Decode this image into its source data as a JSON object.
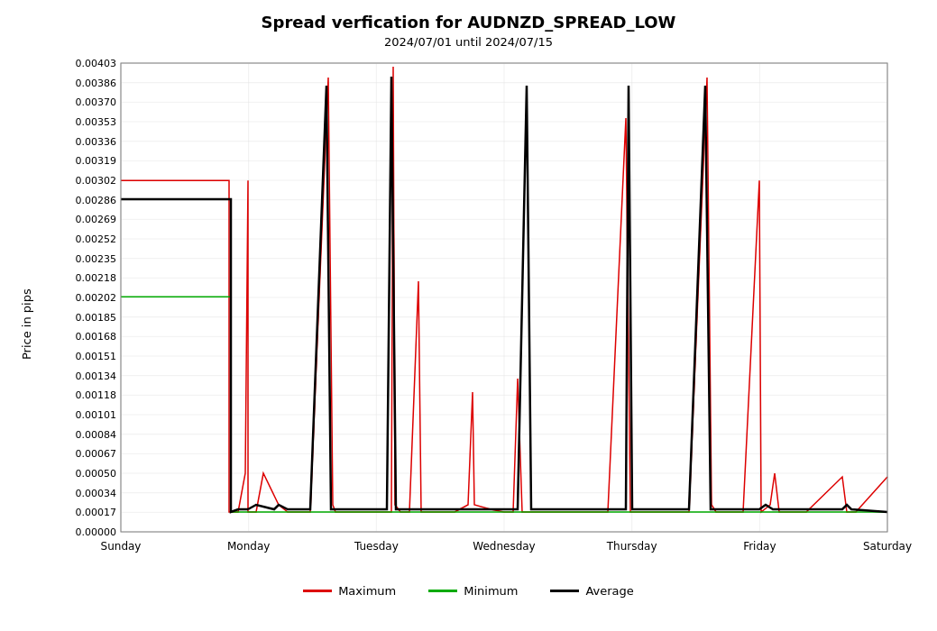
{
  "title": "Spread verfication for AUDNZD_SPREAD_LOW",
  "subtitle": "2024/07/01 until 2024/07/15",
  "yAxisLabel": "Price in pips",
  "yTicks": [
    "0.00403",
    "0.00386",
    "0.00370",
    "0.00353",
    "0.00336",
    "0.00319",
    "0.00302",
    "0.00286",
    "0.00269",
    "0.00252",
    "0.00235",
    "0.00218",
    "0.00202",
    "0.00185",
    "0.00168",
    "0.00151",
    "0.00134",
    "0.00118",
    "0.00101",
    "0.00084",
    "0.00067",
    "0.00050",
    "0.00034",
    "0.00017",
    "0.00000"
  ],
  "xTicks": [
    "Sunday",
    "Monday",
    "Tuesday",
    "Wednesday",
    "Thursday",
    "Friday",
    "Saturday"
  ],
  "legend": [
    {
      "label": "Maximum",
      "color": "#dd0000"
    },
    {
      "label": "Minimum",
      "color": "#00aa00"
    },
    {
      "label": "Average",
      "color": "#000000"
    }
  ]
}
